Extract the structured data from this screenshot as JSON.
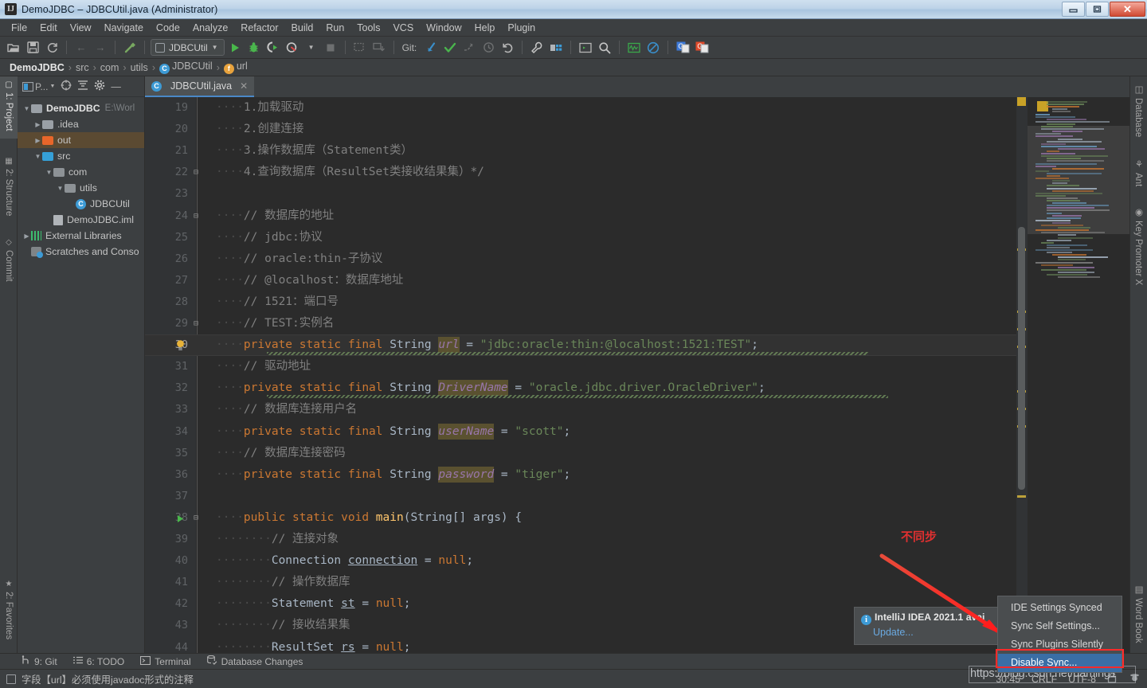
{
  "window": {
    "title": "DemoJDBC – JDBCUtil.java (Administrator)",
    "app_icon": "intellij-idea-icon",
    "minimize": "—",
    "maximize": "❐",
    "close": "✕"
  },
  "menubar": {
    "items": [
      {
        "label": "File"
      },
      {
        "label": "Edit"
      },
      {
        "label": "View"
      },
      {
        "label": "Navigate"
      },
      {
        "label": "Code"
      },
      {
        "label": "Analyze"
      },
      {
        "label": "Refactor"
      },
      {
        "label": "Build"
      },
      {
        "label": "Run"
      },
      {
        "label": "Tools"
      },
      {
        "label": "VCS"
      },
      {
        "label": "Window"
      },
      {
        "label": "Help"
      },
      {
        "label": "Plugin"
      }
    ]
  },
  "toolbar": {
    "open_icon": "folder-open-icon",
    "save_icon": "save-icon",
    "sync_icon": "refresh-icon",
    "back_icon": "arrow-left-icon",
    "forward_icon": "arrow-right-icon",
    "build_icon": "hammer-icon",
    "run_config": "JDBCUtil",
    "run_icon": "run-triangle-icon",
    "debug_icon": "debug-bug-icon",
    "run_coverage_icon": "run-with-coverage-icon",
    "profile_icon": "profiler-icon",
    "stop_icon": "stop-square-icon",
    "git_label": "Git:",
    "update_project_icon": "vcs-update-icon",
    "commit_icon": "vcs-commit-check-icon",
    "push_icon": "vcs-push-icon",
    "history_icon": "vcs-history-clock-icon",
    "rollback_icon": "vcs-rollback-icon",
    "settings_icon": "wrench-icon",
    "project_structure_icon": "project-structure-icon",
    "terminal_icon": "terminal-icon",
    "search_icon": "search-icon",
    "monitor_icon": "activity-monitor-icon",
    "no_icon": "disabled-circle-icon",
    "translate_blue_icon": "google-translate-blue-icon",
    "translate_red_icon": "google-translate-red-icon"
  },
  "breadcrumb": {
    "items": [
      {
        "label": "DemoJDBC",
        "icon": ""
      },
      {
        "label": "src",
        "icon": ""
      },
      {
        "label": "com",
        "icon": ""
      },
      {
        "label": "utils",
        "icon": ""
      },
      {
        "label": "JDBCUtil",
        "icon": "class-icon"
      },
      {
        "label": "url",
        "icon": "field-icon"
      }
    ],
    "separator": "›"
  },
  "left_tool_strip": {
    "tabs": [
      {
        "label": "1: Project",
        "selected": true,
        "icon": "project-icon"
      },
      {
        "label": "2: Structure",
        "selected": false,
        "icon": "structure-icon"
      },
      {
        "label": "Commit",
        "selected": false,
        "icon": "commit-icon"
      },
      {
        "label": "2: Favorites",
        "selected": false,
        "icon": "star-icon"
      }
    ]
  },
  "right_tool_strip": {
    "tabs": [
      {
        "label": "Database",
        "icon": "database-icon"
      },
      {
        "label": "Ant",
        "icon": "ant-icon"
      },
      {
        "label": "Key Promoter X",
        "icon": "key-promoter-icon"
      },
      {
        "label": "Word Book",
        "icon": "word-book-icon"
      }
    ]
  },
  "project_panel": {
    "header": {
      "title": "P...",
      "select_target_icon": "crosshair-icon",
      "collapse_all_icon": "collapse-all-icon",
      "settings_icon": "gear-icon",
      "hide_icon": "minimize-icon"
    },
    "tree": [
      {
        "label": "DemoJDBC",
        "path": "E:\\Worl",
        "indent": 0,
        "arrow": "▼",
        "icon": "module-folder-icon",
        "bold": true,
        "selected": false
      },
      {
        "label": ".idea",
        "path": "",
        "indent": 1,
        "arrow": "▶",
        "icon": "folder-grey-icon",
        "bold": false,
        "selected": false
      },
      {
        "label": "out",
        "path": "",
        "indent": 1,
        "arrow": "▶",
        "icon": "folder-orange-icon",
        "bold": false,
        "selected": true
      },
      {
        "label": "src",
        "path": "",
        "indent": 1,
        "arrow": "▼",
        "icon": "folder-blue-icon",
        "bold": false,
        "selected": false
      },
      {
        "label": "com",
        "path": "",
        "indent": 2,
        "arrow": "▼",
        "icon": "package-icon",
        "bold": false,
        "selected": false
      },
      {
        "label": "utils",
        "path": "",
        "indent": 3,
        "arrow": "▼",
        "icon": "package-icon",
        "bold": false,
        "selected": false
      },
      {
        "label": "JDBCUtil",
        "path": "",
        "indent": 4,
        "arrow": "",
        "icon": "class-icon",
        "bold": false,
        "selected": false
      },
      {
        "label": "DemoJDBC.iml",
        "path": "",
        "indent": 2,
        "arrow": "",
        "icon": "iml-file-icon",
        "bold": false,
        "selected": false
      },
      {
        "label": "External Libraries",
        "path": "",
        "indent": 0,
        "arrow": "▶",
        "icon": "libraries-icon",
        "bold": false,
        "selected": false
      },
      {
        "label": "Scratches and Conso",
        "path": "",
        "indent": 0,
        "arrow": "",
        "icon": "scratches-icon",
        "bold": false,
        "selected": false
      }
    ]
  },
  "editor_tabs": [
    {
      "label": "JDBCUtil.java",
      "icon": "class-icon",
      "close": "✕",
      "active": true
    }
  ],
  "editor": {
    "first_line": 19,
    "lines": [
      {
        "no": 19,
        "segments": [
          {
            "t": "····",
            "c": "ind"
          },
          {
            "t": "1.加载驱动",
            "c": "cmt"
          }
        ]
      },
      {
        "no": 20,
        "segments": [
          {
            "t": "····",
            "c": "ind"
          },
          {
            "t": "2.创建连接",
            "c": "cmt"
          }
        ]
      },
      {
        "no": 21,
        "segments": [
          {
            "t": "····",
            "c": "ind"
          },
          {
            "t": "3.操作数据库（Statement类）",
            "c": "cmt"
          }
        ]
      },
      {
        "no": 22,
        "segments": [
          {
            "t": "····",
            "c": "ind"
          },
          {
            "t": "4.查询数据库（ResultSet类接收结果集）*/",
            "c": "cmt"
          }
        ],
        "fold": "⊟"
      },
      {
        "no": 23,
        "segments": []
      },
      {
        "no": 24,
        "segments": [
          {
            "t": "····",
            "c": "ind"
          },
          {
            "t": "// 数据库的地址",
            "c": "cmt"
          }
        ],
        "fold": "⊟"
      },
      {
        "no": 25,
        "segments": [
          {
            "t": "····",
            "c": "ind"
          },
          {
            "t": "// jdbc:协议",
            "c": "cmt"
          }
        ]
      },
      {
        "no": 26,
        "segments": [
          {
            "t": "····",
            "c": "ind"
          },
          {
            "t": "// oracle:thin-子协议",
            "c": "cmt"
          }
        ]
      },
      {
        "no": 27,
        "segments": [
          {
            "t": "····",
            "c": "ind"
          },
          {
            "t": "// @localhost：数据库地址",
            "c": "cmt"
          }
        ]
      },
      {
        "no": 28,
        "segments": [
          {
            "t": "····",
            "c": "ind"
          },
          {
            "t": "// 1521：端口号",
            "c": "cmt"
          }
        ]
      },
      {
        "no": 29,
        "segments": [
          {
            "t": "····",
            "c": "ind"
          },
          {
            "t": "// TEST:实例名",
            "c": "cmt"
          }
        ],
        "fold": "⊟"
      },
      {
        "no": 30,
        "caret": true,
        "bulb": true,
        "segments": [
          {
            "t": "····",
            "c": "ind"
          },
          {
            "t": "private static final ",
            "c": "kw"
          },
          {
            "t": "String ",
            "c": "cls"
          },
          {
            "t": "url",
            "c": "fldhl"
          },
          {
            "t": " = ",
            "c": "plain"
          },
          {
            "t": "\"jdbc:oracle:thin:@localhost:1521:TEST\"",
            "c": "str"
          },
          {
            "t": ";",
            "c": "plain"
          }
        ]
      },
      {
        "no": 31,
        "segments": [
          {
            "t": "····",
            "c": "ind"
          },
          {
            "t": "// 驱动地址",
            "c": "cmt"
          }
        ]
      },
      {
        "no": 32,
        "segments": [
          {
            "t": "····",
            "c": "ind"
          },
          {
            "t": "private static final ",
            "c": "kw"
          },
          {
            "t": "String ",
            "c": "cls"
          },
          {
            "t": "DriverName",
            "c": "fldhl"
          },
          {
            "t": " = ",
            "c": "plain"
          },
          {
            "t": "\"oracle.jdbc.driver.OracleDriver\"",
            "c": "str"
          },
          {
            "t": ";",
            "c": "plain"
          }
        ]
      },
      {
        "no": 33,
        "segments": [
          {
            "t": "····",
            "c": "ind"
          },
          {
            "t": "// 数据库连接用户名",
            "c": "cmt"
          }
        ]
      },
      {
        "no": 34,
        "segments": [
          {
            "t": "····",
            "c": "ind"
          },
          {
            "t": "private static final ",
            "c": "kw"
          },
          {
            "t": "String ",
            "c": "cls"
          },
          {
            "t": "userName",
            "c": "fldhl"
          },
          {
            "t": " = ",
            "c": "plain"
          },
          {
            "t": "\"scott\"",
            "c": "str"
          },
          {
            "t": ";",
            "c": "plain"
          }
        ]
      },
      {
        "no": 35,
        "segments": [
          {
            "t": "····",
            "c": "ind"
          },
          {
            "t": "// 数据库连接密码",
            "c": "cmt"
          }
        ]
      },
      {
        "no": 36,
        "segments": [
          {
            "t": "····",
            "c": "ind"
          },
          {
            "t": "private static final ",
            "c": "kw"
          },
          {
            "t": "String ",
            "c": "cls"
          },
          {
            "t": "password",
            "c": "fldhl"
          },
          {
            "t": " = ",
            "c": "plain"
          },
          {
            "t": "\"tiger\"",
            "c": "str"
          },
          {
            "t": ";",
            "c": "plain"
          }
        ]
      },
      {
        "no": 37,
        "segments": []
      },
      {
        "no": 38,
        "gutter_run": true,
        "fold": "⊟",
        "segments": [
          {
            "t": "····",
            "c": "ind"
          },
          {
            "t": "public static void ",
            "c": "kw"
          },
          {
            "t": "main",
            "c": "mth"
          },
          {
            "t": "(String[] args) ",
            "c": "plain"
          },
          {
            "t": "{",
            "c": "plain"
          }
        ]
      },
      {
        "no": 39,
        "segments": [
          {
            "t": "········",
            "c": "ind"
          },
          {
            "t": "// 连接对象",
            "c": "cmt"
          }
        ]
      },
      {
        "no": 40,
        "segments": [
          {
            "t": "········",
            "c": "ind"
          },
          {
            "t": "Connection ",
            "c": "cls"
          },
          {
            "t": "connection",
            "c": "undl"
          },
          {
            "t": " = ",
            "c": "plain"
          },
          {
            "t": "null",
            "c": "kw2"
          },
          {
            "t": ";",
            "c": "plain"
          }
        ]
      },
      {
        "no": 41,
        "segments": [
          {
            "t": "········",
            "c": "ind"
          },
          {
            "t": "// 操作数据库",
            "c": "cmt"
          }
        ]
      },
      {
        "no": 42,
        "segments": [
          {
            "t": "········",
            "c": "ind"
          },
          {
            "t": "Statement ",
            "c": "cls"
          },
          {
            "t": "st",
            "c": "undl"
          },
          {
            "t": " = ",
            "c": "plain"
          },
          {
            "t": "null",
            "c": "kw2"
          },
          {
            "t": ";",
            "c": "plain"
          }
        ]
      },
      {
        "no": 43,
        "segments": [
          {
            "t": "········",
            "c": "ind"
          },
          {
            "t": "// 接收结果集",
            "c": "cmt"
          }
        ]
      },
      {
        "no": 44,
        "segments": [
          {
            "t": "········",
            "c": "ind"
          },
          {
            "t": "ResultSet ",
            "c": "cls"
          },
          {
            "t": "rs",
            "c": "undl"
          },
          {
            "t": " = ",
            "c": "plain"
          },
          {
            "t": "null",
            "c": "kw2"
          },
          {
            "t": ";",
            "c": "plain"
          }
        ]
      }
    ]
  },
  "annotation": {
    "text": "不同步",
    "color": "#e03030",
    "arrow": "red-arrow-pointing-down-right"
  },
  "notification": {
    "icon": "info-icon",
    "title": "IntelliJ IDEA 2021.1 avai",
    "link": "Update..."
  },
  "context_menu": {
    "items": [
      {
        "label": "IDE Settings Synced",
        "selected": false
      },
      {
        "label": "Sync Self Settings...",
        "selected": false
      },
      {
        "label": "Sync Plugins Silently",
        "selected": false
      },
      {
        "label": "Disable Sync...",
        "selected": true
      }
    ],
    "highlight_color": "#ff2a2a"
  },
  "bottom_tool_strip": {
    "tabs": [
      {
        "label": "9: Git",
        "icon": "git-branch-icon"
      },
      {
        "label": "6: TODO",
        "icon": "todo-list-icon"
      },
      {
        "label": "Terminal",
        "icon": "terminal-icon"
      },
      {
        "label": "Database Changes",
        "icon": "database-changes-icon"
      }
    ]
  },
  "status_bar": {
    "message_icon": "inspection-icon",
    "message": "字段【url】必须使用javadoc形式的注释",
    "caret_position": "30:45",
    "line_separator": "CRLF",
    "encoding": "UTF-8",
    "lock_icon": "unlock-icon",
    "inspector_icon": "hector-inspector-icon"
  },
  "watermark": {
    "text": "https://blog.csdn.net/daming1"
  }
}
